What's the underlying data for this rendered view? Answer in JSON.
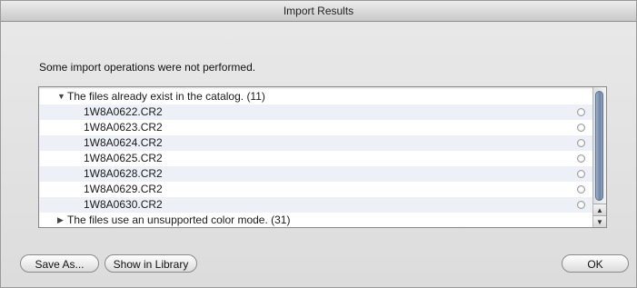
{
  "window": {
    "title": "Import Results"
  },
  "message": "Some import operations were not performed.",
  "list": {
    "groups": [
      {
        "label": "The files already exist in the catalog. (11)",
        "expanded": true,
        "files": [
          "1W8A0622.CR2",
          "1W8A0623.CR2",
          "1W8A0624.CR2",
          "1W8A0625.CR2",
          "1W8A0628.CR2",
          "1W8A0629.CR2",
          "1W8A0630.CR2"
        ]
      },
      {
        "label": "The files use an unsupported color mode. (31)",
        "expanded": false,
        "files": []
      }
    ]
  },
  "icons": {
    "expanded": "▼",
    "collapsed": "▶",
    "scroll_up": "▲",
    "scroll_down": "▼"
  },
  "buttons": {
    "save_as": "Save As...",
    "show_in_library": "Show in Library",
    "ok": "OK"
  }
}
